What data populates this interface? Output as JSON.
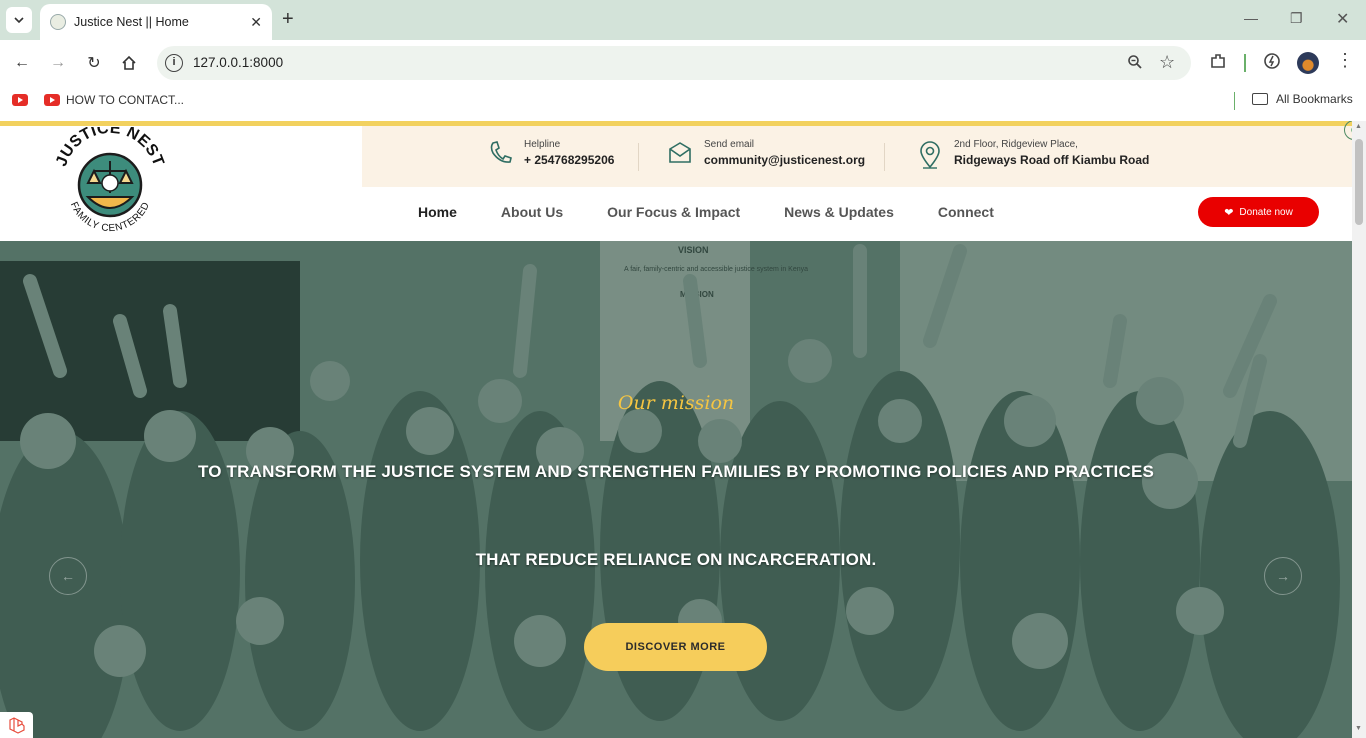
{
  "browser": {
    "tab_title": "Justice Nest || Home",
    "url": "127.0.0.1:8000",
    "bookmark_label": "HOW TO CONTACT...",
    "all_bookmarks": "All Bookmarks"
  },
  "topbar": {
    "helpline_label": "Helpline",
    "helpline_value": "+ 254768295206",
    "email_label": "Send email",
    "email_value": "community@justicenest.org",
    "address_label": "2nd Floor, Ridgeview Place,",
    "address_value": "Ridgeways Road off Kiambu Road"
  },
  "logo": {
    "line1": "JUSTICE NEST",
    "line2": "FAMILY CENTERED"
  },
  "nav": {
    "items": [
      "Home",
      "About Us",
      "Our Focus & Impact",
      "News & Updates",
      "Connect"
    ],
    "donate": "Donate now"
  },
  "hero": {
    "label": "Our mission",
    "line1": "TO TRANSFORM THE JUSTICE SYSTEM AND STRENGTHEN FAMILIES BY PROMOTING POLICIES AND PRACTICES",
    "line2": "THAT REDUCE RELIANCE ON INCARCERATION.",
    "cta": "DISCOVER MORE",
    "board_heading": "VISION",
    "board_text": "A fair, family-centric and accessible justice system in Kenya",
    "board_heading2": "MISSION"
  },
  "colors": {
    "accent_yellow": "#f6cd5b",
    "donate_red": "#e90000",
    "brand_green": "#2f6e63"
  }
}
